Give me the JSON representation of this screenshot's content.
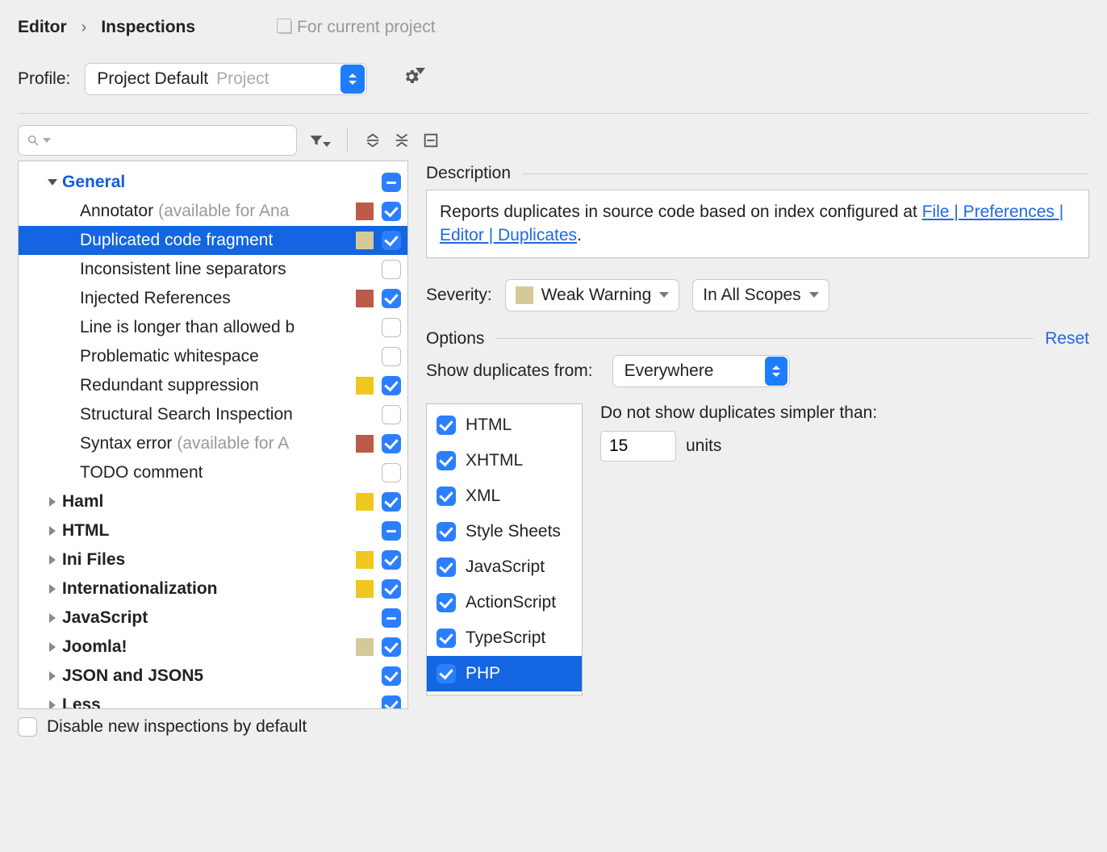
{
  "breadcrumb": {
    "editor": "Editor",
    "sep": "›",
    "inspections": "Inspections",
    "scope_hint": "For current project"
  },
  "profile": {
    "label": "Profile:",
    "name": "Project Default",
    "scope": "Project"
  },
  "severity": {
    "label": "Severity:",
    "value": "Weak Warning",
    "scope": "In All Scopes"
  },
  "description": {
    "title": "Description",
    "text_prefix": "Reports duplicates in source code based on index configured at ",
    "link": "File | Preferences | Editor | Duplicates",
    "suffix": "."
  },
  "options": {
    "title": "Options",
    "reset": "Reset",
    "show_dup_label": "Show duplicates from:",
    "show_dup_value": "Everywhere",
    "threshold_label": "Do not show duplicates simpler than:",
    "threshold_value": "15",
    "threshold_units": "units"
  },
  "languages": [
    "HTML",
    "XHTML",
    "XML",
    "Style Sheets",
    "JavaScript",
    "ActionScript",
    "TypeScript",
    "PHP"
  ],
  "tree": {
    "general": "General",
    "items": [
      {
        "label": "Annotator",
        "hint": "(available for Ana",
        "swatch": "#bd5a49",
        "check": "on"
      },
      {
        "label": "Duplicated code fragment",
        "hint": "",
        "swatch": "#d6c999",
        "check": "on",
        "selected": true
      },
      {
        "label": "Inconsistent line separators",
        "hint": "",
        "swatch": "",
        "check": "off"
      },
      {
        "label": "Injected References",
        "hint": "",
        "swatch": "#bd5a49",
        "check": "on"
      },
      {
        "label": "Line is longer than allowed b",
        "hint": "",
        "swatch": "",
        "check": "off"
      },
      {
        "label": "Problematic whitespace",
        "hint": "",
        "swatch": "",
        "check": "off"
      },
      {
        "label": "Redundant suppression",
        "hint": "",
        "swatch": "#eec71f",
        "check": "on"
      },
      {
        "label": "Structural Search Inspection",
        "hint": "",
        "swatch": "",
        "check": "off"
      },
      {
        "label": "Syntax error",
        "hint": "(available for A",
        "swatch": "#bd5a49",
        "check": "on"
      },
      {
        "label": "TODO comment",
        "hint": "",
        "swatch": "",
        "check": "off"
      }
    ],
    "cats": [
      {
        "label": "Haml",
        "swatch": "#eec71f",
        "check": "on"
      },
      {
        "label": "HTML",
        "swatch": "",
        "check": "mixed"
      },
      {
        "label": "Ini Files",
        "swatch": "#eec71f",
        "check": "on"
      },
      {
        "label": "Internationalization",
        "swatch": "#eec71f",
        "check": "on"
      },
      {
        "label": "JavaScript",
        "swatch": "",
        "check": "mixed"
      },
      {
        "label": "Joomla!",
        "swatch": "#d6c999",
        "check": "on"
      },
      {
        "label": "JSON and JSON5",
        "swatch": "",
        "check": "on"
      },
      {
        "label": "Less",
        "swatch": "",
        "check": "on"
      }
    ]
  },
  "disable_label": "Disable new inspections by default"
}
